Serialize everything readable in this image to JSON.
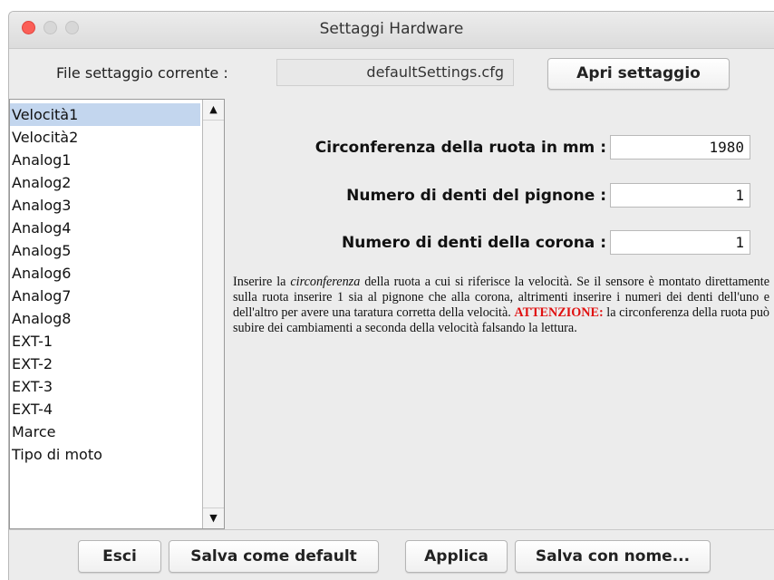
{
  "window": {
    "title": "Settaggi Hardware"
  },
  "header": {
    "file_label": "File settaggio corrente :",
    "file_value": "defaultSettings.cfg",
    "open_button": "Apri settaggio"
  },
  "sidebar": {
    "items": [
      {
        "label": "Velocità1",
        "selected": true
      },
      {
        "label": "Velocità2",
        "selected": false
      },
      {
        "label": "Analog1",
        "selected": false
      },
      {
        "label": "Analog2",
        "selected": false
      },
      {
        "label": "Analog3",
        "selected": false
      },
      {
        "label": "Analog4",
        "selected": false
      },
      {
        "label": "Analog5",
        "selected": false
      },
      {
        "label": "Analog6",
        "selected": false
      },
      {
        "label": "Analog7",
        "selected": false
      },
      {
        "label": "Analog8",
        "selected": false
      },
      {
        "label": "EXT-1",
        "selected": false
      },
      {
        "label": "EXT-2",
        "selected": false
      },
      {
        "label": "EXT-3",
        "selected": false
      },
      {
        "label": "EXT-4",
        "selected": false
      },
      {
        "label": "Marce",
        "selected": false
      },
      {
        "label": "Tipo di moto",
        "selected": false
      }
    ],
    "scroll_up_icon": "arrow-up-icon",
    "scroll_down_icon": "arrow-down-icon"
  },
  "form": {
    "fields": [
      {
        "label": "Circonferenza della ruota in mm :",
        "value": "1980"
      },
      {
        "label": "Numero di denti del pignone :",
        "value": "1"
      },
      {
        "label": "Numero di denti della corona :",
        "value": "1"
      }
    ]
  },
  "info": {
    "part1": "Inserire la ",
    "italic": "circonferenza",
    "part2": "  della ruota a cui si riferisce la velocità. Se il sensore è montato direttamente sulla ruota inserire 1 sia al pignone che alla corona, altrimenti inserire i numeri dei denti dell'uno e dell'altro per avere una taratura corretta della velocità. ",
    "warning": "ATTENZIONE:",
    "part3": " la circonferenza della ruota può subire dei cambiamenti a seconda della velocità falsando la lettura."
  },
  "footer": {
    "exit": "Esci",
    "save_default": "Salva come default",
    "apply": "Applica",
    "save_as": "Salva con nome..."
  },
  "colors": {
    "selection": "#c3d6ee",
    "warning": "#e01010",
    "close_button": "#fb5f57"
  }
}
